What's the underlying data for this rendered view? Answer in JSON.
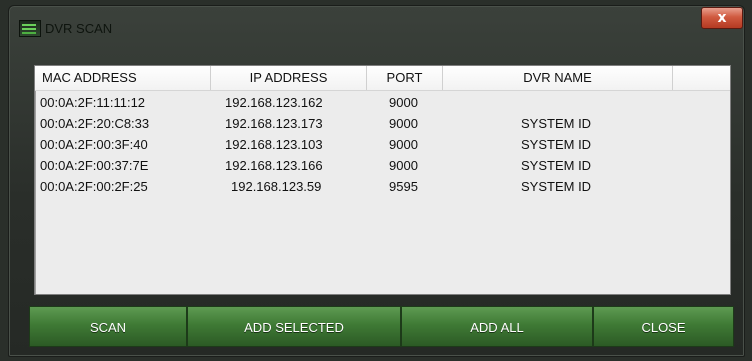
{
  "window": {
    "title": "DVR SCAN",
    "close_label": "x"
  },
  "table": {
    "columns": [
      "MAC ADDRESS",
      "IP ADDRESS",
      "PORT",
      "DVR NAME"
    ],
    "rows": [
      {
        "mac": "00:0A:2F:11:11:12",
        "ip": "192.168.123.162",
        "port": "9000",
        "name": ""
      },
      {
        "mac": "00:0A:2F:20:C8:33",
        "ip": "192.168.123.173",
        "port": "9000",
        "name": "SYSTEM ID"
      },
      {
        "mac": "00:0A:2F:00:3F:40",
        "ip": "192.168.123.103",
        "port": "9000",
        "name": "SYSTEM ID"
      },
      {
        "mac": "00:0A:2F:00:37:7E",
        "ip": "192.168.123.166",
        "port": "9000",
        "name": "SYSTEM ID"
      },
      {
        "mac": "00:0A:2F:00:2F:25",
        "ip": "192.168.123.59",
        "port": "9595",
        "name": "SYSTEM ID"
      }
    ]
  },
  "buttons": {
    "scan": "SCAN",
    "add_selected": "ADD SELECTED",
    "add_all": "ADD ALL",
    "close": "CLOSE"
  },
  "icons": {
    "app": "dvr-app-icon",
    "close": "close-icon"
  }
}
